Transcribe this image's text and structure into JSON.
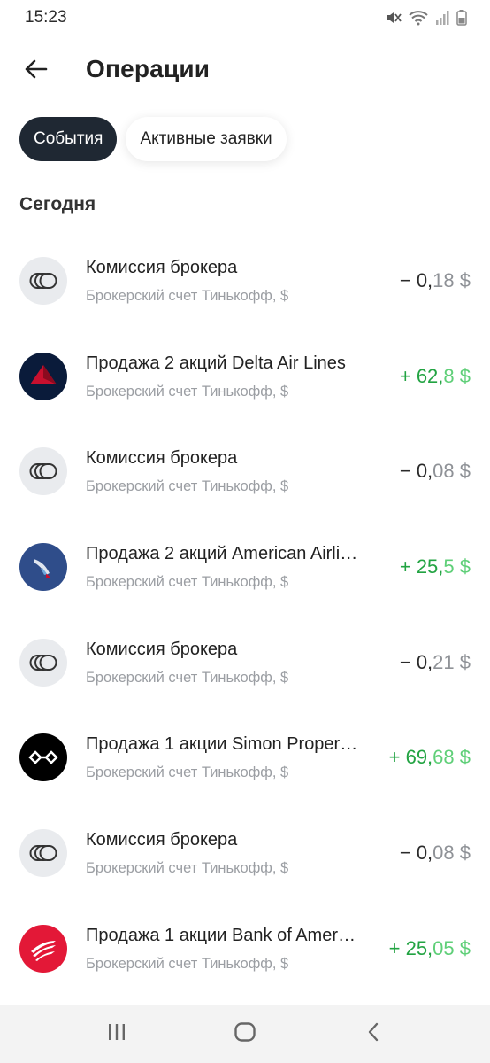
{
  "status_bar": {
    "time": "15:23",
    "icons": [
      "mute-icon",
      "wifi-icon",
      "signal-icon",
      "battery-icon"
    ]
  },
  "header": {
    "back_icon": "arrow-left-icon",
    "title": "Операции"
  },
  "tabs": [
    {
      "label": "События",
      "active": true
    },
    {
      "label": "Активные заявки",
      "active": false
    }
  ],
  "section": {
    "title": "Сегодня"
  },
  "colors": {
    "tab_active_bg": "#1f2833",
    "positive_amount": "#22a342",
    "negative_amount": "#2a2a2a",
    "subtitle": "#9b9ea3",
    "commission_icon_bg": "#e9ebee"
  },
  "operations": [
    {
      "icon": "broker-commission-icon",
      "title": "Комиссия брокера",
      "subtitle": "Брокерский счет Тинькофф, $",
      "amount_main": "− 0,",
      "amount_rest": "18 $",
      "direction": "negative"
    },
    {
      "icon": "delta-air-lines-logo",
      "title": "Продажа 2 акций Delta Air Lines",
      "subtitle": "Брокерский счет Тинькофф, $",
      "amount_main": "+ 62,",
      "amount_rest": "8 $",
      "direction": "positive"
    },
    {
      "icon": "broker-commission-icon",
      "title": "Комиссия брокера",
      "subtitle": "Брокерский счет Тинькофф, $",
      "amount_main": "− 0,",
      "amount_rest": "08 $",
      "direction": "negative"
    },
    {
      "icon": "american-airlines-logo",
      "title": "Продажа 2 акций American Airli…",
      "subtitle": "Брокерский счет Тинькофф, $",
      "amount_main": "+ 25,",
      "amount_rest": "5 $",
      "direction": "positive"
    },
    {
      "icon": "broker-commission-icon",
      "title": "Комиссия брокера",
      "subtitle": "Брокерский счет Тинькофф, $",
      "amount_main": "− 0,",
      "amount_rest": "21 $",
      "direction": "negative"
    },
    {
      "icon": "simon-property-logo",
      "title": "Продажа 1 акции Simon Proper…",
      "subtitle": "Брокерский счет Тинькофф, $",
      "amount_main": "+ 69,",
      "amount_rest": "68 $",
      "direction": "positive"
    },
    {
      "icon": "broker-commission-icon",
      "title": "Комиссия брокера",
      "subtitle": "Брокерский счет Тинькофф, $",
      "amount_main": "− 0,",
      "amount_rest": "08 $",
      "direction": "negative"
    },
    {
      "icon": "bank-of-america-logo",
      "title": "Продажа 1 акции Bank of Amer…",
      "subtitle": "Брокерский счет Тинькофф, $",
      "amount_main": "+ 25,",
      "amount_rest": "05 $",
      "direction": "positive"
    }
  ],
  "nav_bar": {
    "buttons": [
      "recent-apps-icon",
      "home-icon",
      "back-icon"
    ]
  }
}
